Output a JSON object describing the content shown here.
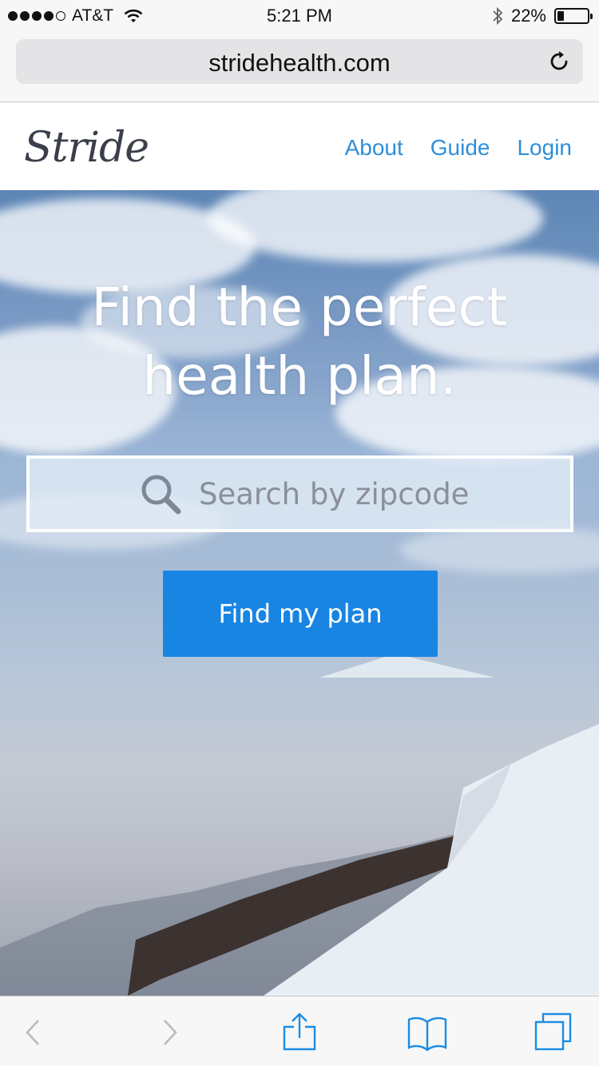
{
  "status_bar": {
    "carrier": "AT&T",
    "time": "5:21 PM",
    "battery_percent": "22%",
    "battery_level": 0.22,
    "signal_bars_filled": 4,
    "signal_bars_total": 5
  },
  "browser": {
    "url": "stridehealth.com"
  },
  "site": {
    "logo": "Stride",
    "nav": {
      "about": "About",
      "guide": "Guide",
      "login": "Login"
    },
    "hero": {
      "title_line1": "Find the perfect",
      "title_line2": "health plan.",
      "search_placeholder": "Search by zipcode",
      "cta": "Find my plan"
    }
  },
  "colors": {
    "accent": "#1985e3",
    "nav_link": "#2f8fd8",
    "ios_blue": "#1a8ce4"
  },
  "toolbar_icons": [
    "back-icon",
    "forward-icon",
    "share-icon",
    "bookmarks-icon",
    "tabs-icon"
  ]
}
